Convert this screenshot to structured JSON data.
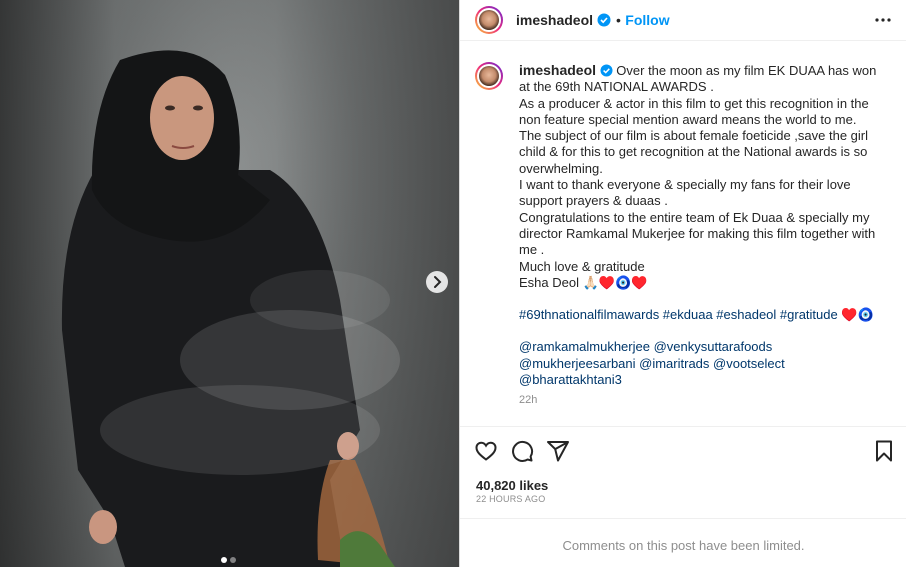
{
  "post": {
    "username": "imeshadeol",
    "follow_label": "Follow",
    "separator": "•",
    "caption_lines": [
      "Over the moon as my film EK DUAA has won at the 69th NATIONAL AWARDS .",
      "As a producer & actor in this film to get this recognition in the non feature special mention award means the world to me. The subject of our film is about female foeticide ,save the girl child & for this to get recognition at the National awards is so overwhelming.",
      "I want to thank everyone & specially my fans for their love support prayers & duaas .",
      "Congratulations to the entire team of Ek Duaa & specially my director Ramkamal Mukerjee for making this film together with me .",
      "Much love & gratitude",
      "Esha Deol 🙏🏻♥️🧿♥️"
    ],
    "hashtags": "#69thnationalfilmawards #ekduaa #eshadeol #gratitude",
    "hashtag_emoji": "♥️🧿",
    "mentions": "@ramkamalmukherjee @venkysuttarafoods @mukherjeesarbani @imaritrads @vootselect @bharattakhtani3",
    "time_ago": "22h",
    "likes": "40,820 likes",
    "date": "22 HOURS AGO",
    "comments_limited": "Comments on this post have been limited."
  },
  "icons": [
    "verified-badge-icon",
    "more-options-icon",
    "heart-icon",
    "comment-icon",
    "share-icon",
    "save-icon",
    "next-arrow-icon"
  ],
  "colors": {
    "link": "#0095f6",
    "hashtag": "#00376b",
    "muted": "#8e8e8e",
    "text": "#262626"
  },
  "carousel": {
    "current": 1,
    "total": 2
  }
}
